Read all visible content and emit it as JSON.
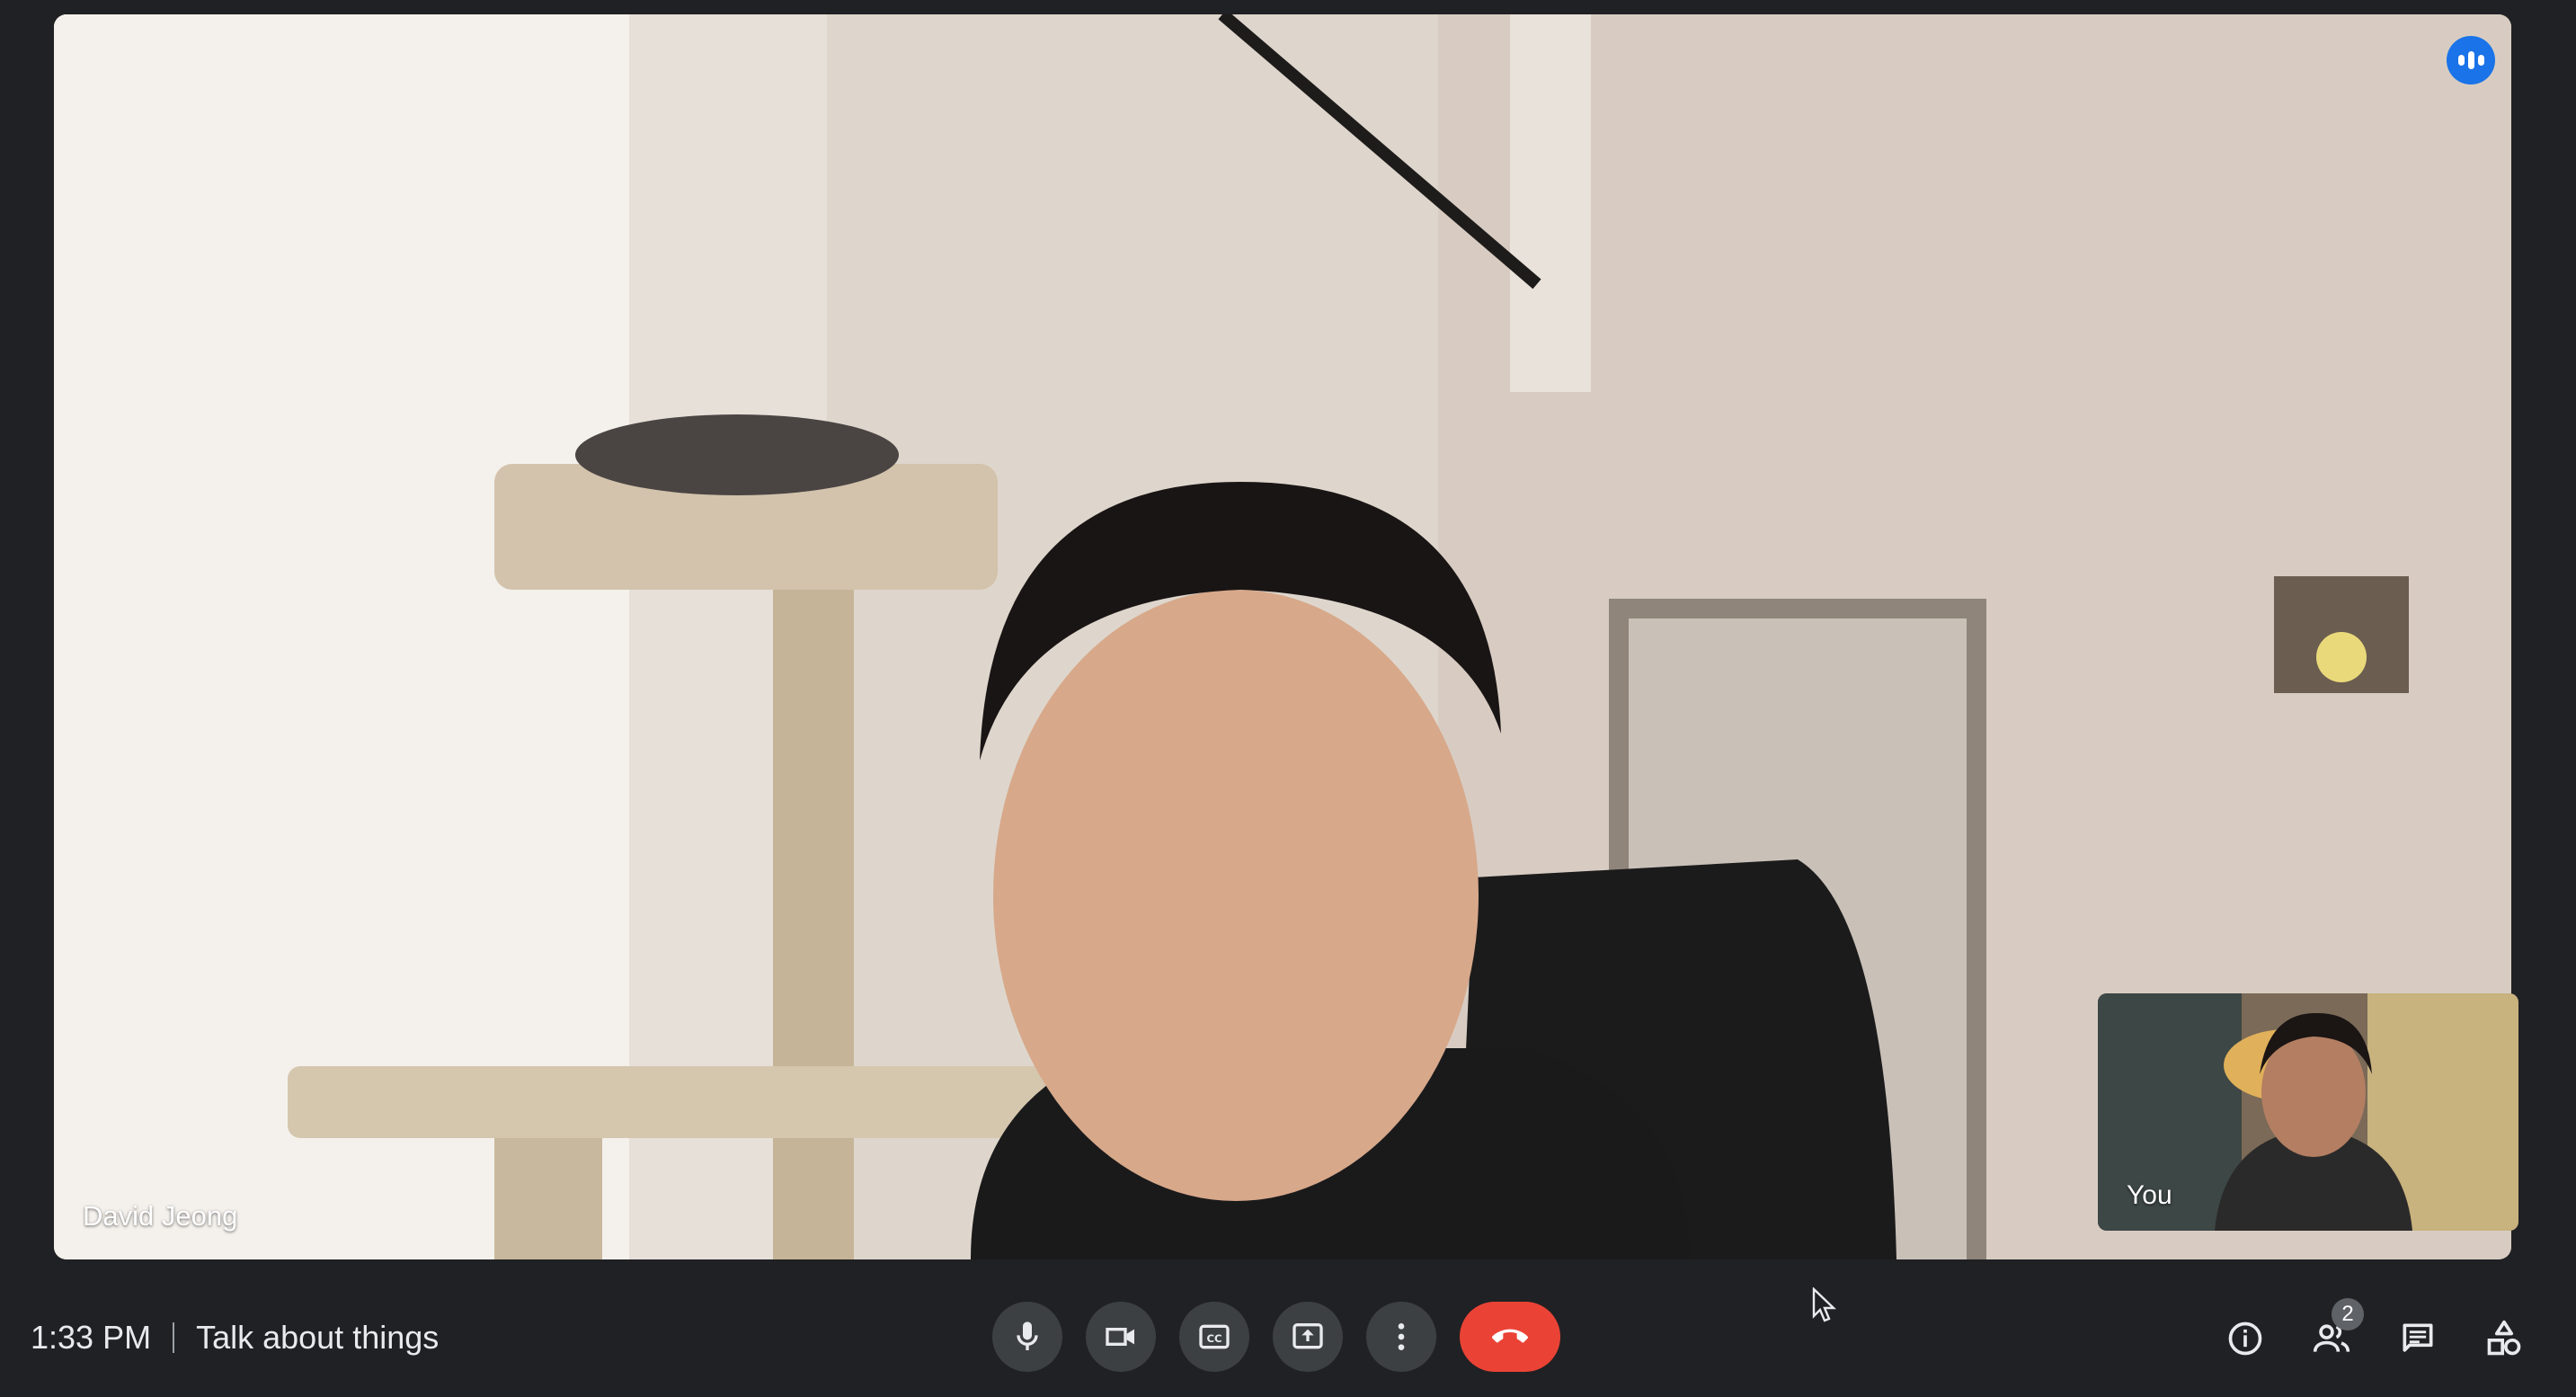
{
  "meeting": {
    "time": "1:33 PM",
    "title": "Talk about things"
  },
  "participants": {
    "main_name": "David Jeong",
    "self_label": "You",
    "count": "2"
  },
  "controls": [
    {
      "name": "microphone-button",
      "icon": "mic-icon"
    },
    {
      "name": "camera-button",
      "icon": "videocam-icon"
    },
    {
      "name": "captions-button",
      "icon": "closed-caption-icon"
    },
    {
      "name": "present-button",
      "icon": "present-screen-icon"
    },
    {
      "name": "more-options-button",
      "icon": "more-vert-icon"
    },
    {
      "name": "leave-call-button",
      "icon": "call-end-icon"
    }
  ],
  "right_actions": [
    {
      "name": "meeting-details-button",
      "icon": "info-icon"
    },
    {
      "name": "people-button",
      "icon": "people-icon"
    },
    {
      "name": "chat-button",
      "icon": "chat-icon"
    },
    {
      "name": "activities-button",
      "icon": "activities-icon"
    }
  ],
  "colors": {
    "background": "#202124",
    "control_bg": "#3c4043",
    "end_call": "#ea4335",
    "speaking_indicator": "#1a73e8"
  }
}
